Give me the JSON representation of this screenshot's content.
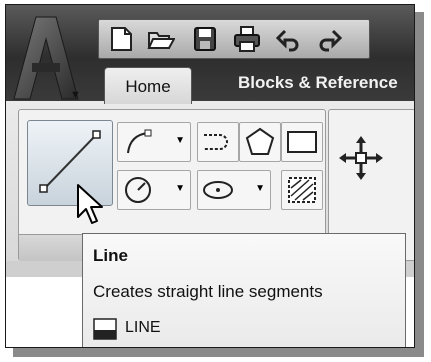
{
  "app": {
    "logo_letter": "A"
  },
  "quick_access": {
    "icons": [
      "new-icon",
      "open-icon",
      "save-icon",
      "print-icon",
      "undo-icon",
      "redo-icon"
    ]
  },
  "tabs": [
    {
      "label": "Home",
      "active": true
    },
    {
      "label": "Blocks & Reference"
    }
  ],
  "draw_panel": {
    "tools": [
      "line",
      "polyline",
      "arc",
      "circle",
      "ellipse",
      "polygon",
      "rectangle",
      "hatch"
    ]
  },
  "modify_panel": {
    "tools": [
      "move"
    ]
  },
  "tooltip": {
    "title": "Line",
    "description": "Creates straight line segments",
    "command": "LINE"
  },
  "colors": {
    "ribbon_bg": "#e4e4e4",
    "title_bar": "#3d3d3d",
    "tooltip_bg": "#f4f4f4"
  }
}
